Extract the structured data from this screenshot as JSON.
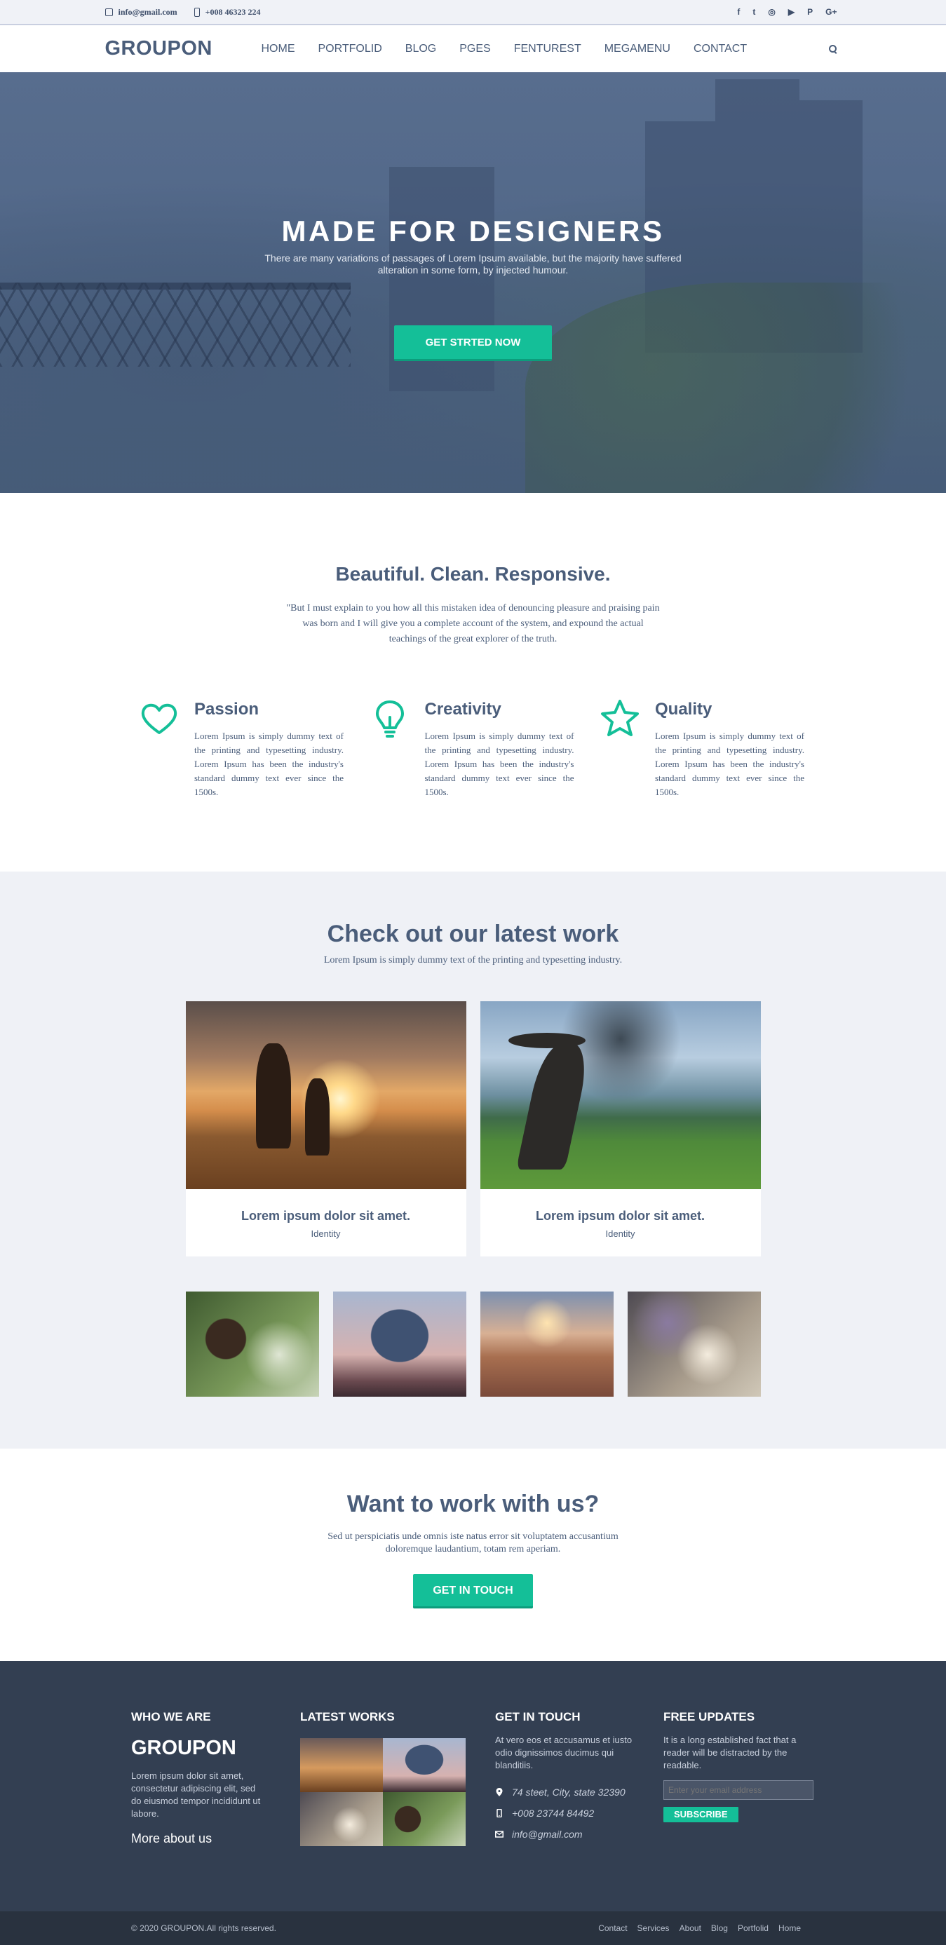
{
  "topbar": {
    "email": "info@gmail.com",
    "phone": "+008 46323 224",
    "social": [
      "f",
      "t",
      "◎",
      "▶",
      "P",
      "G+"
    ]
  },
  "nav": {
    "logo": "GROUPON",
    "items": [
      "HOME",
      "PORTFOLID",
      "BLOG",
      "PGES",
      "FENTUREST",
      "MEGAMENU",
      "CONTACT"
    ]
  },
  "hero": {
    "title": "MADE FOR DESIGNERS",
    "text": "There are many variations of passages of Lorem Ipsum available, but the majority have suffered alteration in some form, by injected humour.",
    "button": "GET STRTED NOW"
  },
  "features": {
    "title": "Beautiful. Clean. Responsive.",
    "intro": "\"But I must explain to you how all this mistaken idea of denouncing pleasure and praising pain was born and I will give you a complete account of the system, and expound the actual teachings of the great explorer of the truth.",
    "items": [
      {
        "icon": "heart-icon",
        "title": "Passion",
        "text": "Lorem Ipsum is simply dummy text of the printing and typesetting industry. Lorem Ipsum has been the industry's standard dummy text ever since the 1500s."
      },
      {
        "icon": "lightbulb-icon",
        "title": "Creativity",
        "text": "Lorem Ipsum is simply dummy text of the printing and typesetting industry. Lorem Ipsum has been the industry's standard dummy text ever since the 1500s."
      },
      {
        "icon": "star-icon",
        "title": "Quality",
        "text": "Lorem Ipsum is simply dummy text of the printing and typesetting industry. Lorem Ipsum has been the industry's standard dummy text ever since the 1500s."
      }
    ]
  },
  "work": {
    "title": "Check out our latest work",
    "subtitle": "Lorem Ipsum is simply dummy text of the printing and typesetting industry.",
    "cards": [
      {
        "title": "Lorem ipsum dolor sit amet.",
        "tag": "Identity"
      },
      {
        "title": "Lorem ipsum dolor sit amet.",
        "tag": "Identity"
      }
    ]
  },
  "cta": {
    "title": "Want to work with us?",
    "text": "Sed ut perspiciatis unde omnis iste natus error sit voluptatem accusantium doloremque laudantium, totam rem aperiam.",
    "button": "GET IN TOUCH"
  },
  "footer": {
    "who": {
      "heading": "WHO WE ARE",
      "logo": "GROUPON",
      "text": "Lorem ipsum dolor sit amet, consectetur adipiscing elit, sed do eiusmod tempor incididunt ut labore.",
      "more": "More about us"
    },
    "works": {
      "heading": "LATEST WORKS"
    },
    "touch": {
      "heading": "GET IN TOUCH",
      "text": "At vero eos et accusamus et iusto odio dignissimos ducimus qui blanditiis.",
      "address": "74 steet, City, state 32390",
      "phone": "+008 23744 84492",
      "email": "info@gmail.com"
    },
    "updates": {
      "heading": "FREE UPDATES",
      "text": "It is a long established fact that a reader will be distracted by the readable.",
      "placeholder": "Enter your email address",
      "button": "SUBSCRIBE"
    }
  },
  "copyright": {
    "text": "© 2020 GROUPON.All rights reserved.",
    "links": [
      "Contact",
      "Services",
      "About",
      "Blog",
      "Portfolid",
      "Home"
    ]
  },
  "colors": {
    "accent": "#14bf98",
    "text": "#4a5d7a",
    "footer": "#333f52",
    "footer_bottom": "#29323f"
  }
}
